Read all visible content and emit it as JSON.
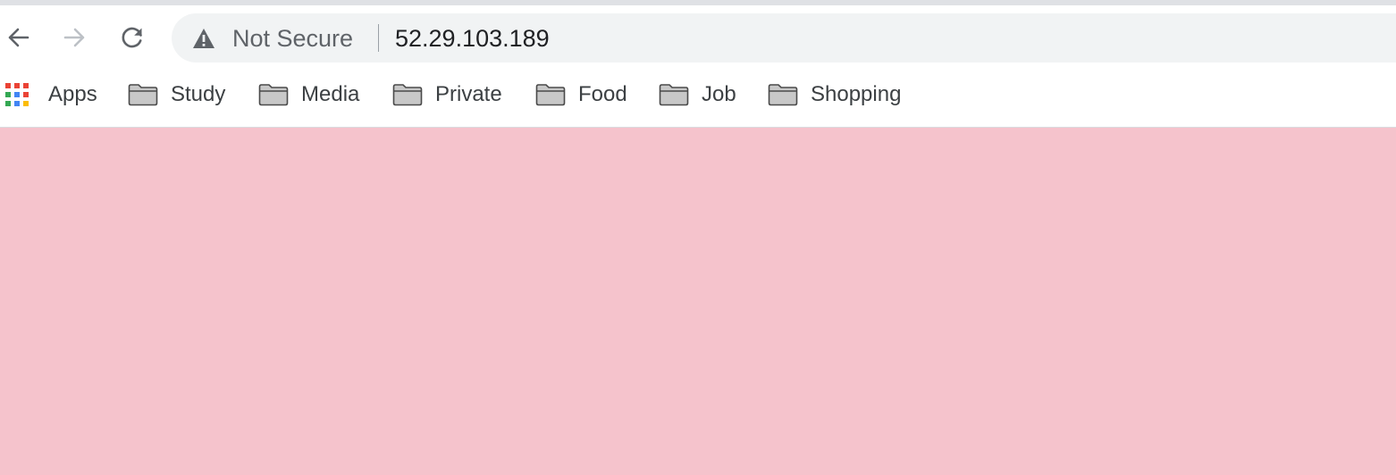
{
  "browser": {
    "nav": {
      "back_icon": "back-arrow-icon",
      "forward_icon": "forward-arrow-icon",
      "reload_icon": "reload-icon"
    },
    "omnibox": {
      "security_icon": "warning-triangle-icon",
      "security_label": "Not Secure",
      "url": "52.29.103.189"
    },
    "bookmarks": [
      {
        "label": "Apps",
        "icon": "apps-grid-icon"
      },
      {
        "label": "Study",
        "icon": "folder-icon"
      },
      {
        "label": "Media",
        "icon": "folder-icon"
      },
      {
        "label": "Private",
        "icon": "folder-icon"
      },
      {
        "label": "Food",
        "icon": "folder-icon"
      },
      {
        "label": "Job",
        "icon": "folder-icon"
      },
      {
        "label": "Shopping",
        "icon": "folder-icon"
      }
    ]
  },
  "page": {
    "background_color": "#f5c3cc"
  },
  "colors": {
    "apps_grid": [
      "#ea4335",
      "#ea4335",
      "#ea4335",
      "#34a853",
      "#4285f4",
      "#ea4335",
      "#34a853",
      "#4285f4",
      "#fbbc05"
    ]
  }
}
